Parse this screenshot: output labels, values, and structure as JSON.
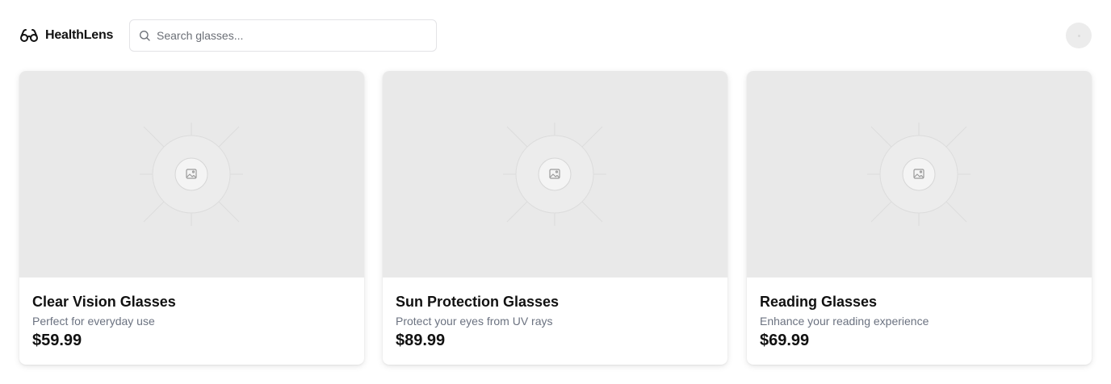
{
  "header": {
    "brand_name": "HealthLens",
    "brand_icon": "glasses-icon",
    "search_placeholder": "Search glasses...",
    "search_value": "",
    "search_icon": "search-icon",
    "avatar_icon": "avatar"
  },
  "products": [
    {
      "title": "Clear Vision Glasses",
      "description": "Perfect for everyday use",
      "price": "$59.99",
      "image_icon": "image-placeholder-icon"
    },
    {
      "title": "Sun Protection Glasses",
      "description": "Protect your eyes from UV rays",
      "price": "$89.99",
      "image_icon": "image-placeholder-icon"
    },
    {
      "title": "Reading Glasses",
      "description": "Enhance your reading experience",
      "price": "$69.99",
      "image_icon": "image-placeholder-icon"
    }
  ],
  "colors": {
    "text_primary": "#111111",
    "text_secondary": "#6b7280",
    "image_placeholder_bg": "#e9e9e9",
    "border": "#e3e3e6"
  }
}
